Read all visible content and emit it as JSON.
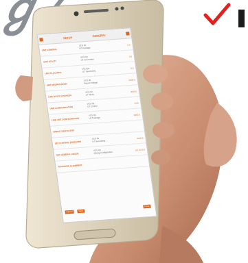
{
  "corner_text": "ℊ ⁄",
  "colors": {
    "accent": "#e0661c",
    "check": "#e2201d",
    "phone_body": "#d7ccb6",
    "skin": "#d39f86"
  },
  "app": {
    "tabs": [
      "SETUP",
      "GENERAL"
    ],
    "rows": [
      {
        "label": "UNIT GENERAL",
        "value": "VCU 00\nUT Package",
        "right": "0.0"
      },
      {
        "label": "UNIT UTILITY",
        "value": "VCU 00\nUT Secondary",
        "right": "0.0"
      },
      {
        "label": "UNIT PLUG INFO",
        "value": "VCU 00\nUT Secondary",
        "right": "0.0"
      },
      {
        "label": "UNIT DEGRADATION",
        "value": "VCU 00\nReport Voltage",
        "right": "0000.0"
      },
      {
        "label": "LINE BLOCK CHANGES",
        "value": "VCU 00\nUT Mode",
        "right": "0000.0"
      },
      {
        "label": "UNIT COMMUNICATION",
        "value": "VCU 00\nUT Control",
        "right": "0.00"
      },
      {
        "label": "LINE UNIT CONFIGURATION",
        "value": "VCU 00\nUT Package",
        "right": "0000.0"
      },
      {
        "label": "SIMPLE VIEW BLEND",
        "value": "",
        "right": ""
      },
      {
        "label": "SET CONTROL PRESSURE",
        "value": "VCU 00\nUT Secondary",
        "right": "0000.0"
      },
      {
        "label": "SET GENERAL ABCDE",
        "value": "VCU 00\nMixing Configuration",
        "right": "0.0 0.0 0.0"
      },
      {
        "label": "ADVANCED ALIGNMENT",
        "value": "",
        "right": ""
      }
    ],
    "bottom_buttons": [
      "Cancel",
      "Save",
      "Done"
    ]
  }
}
